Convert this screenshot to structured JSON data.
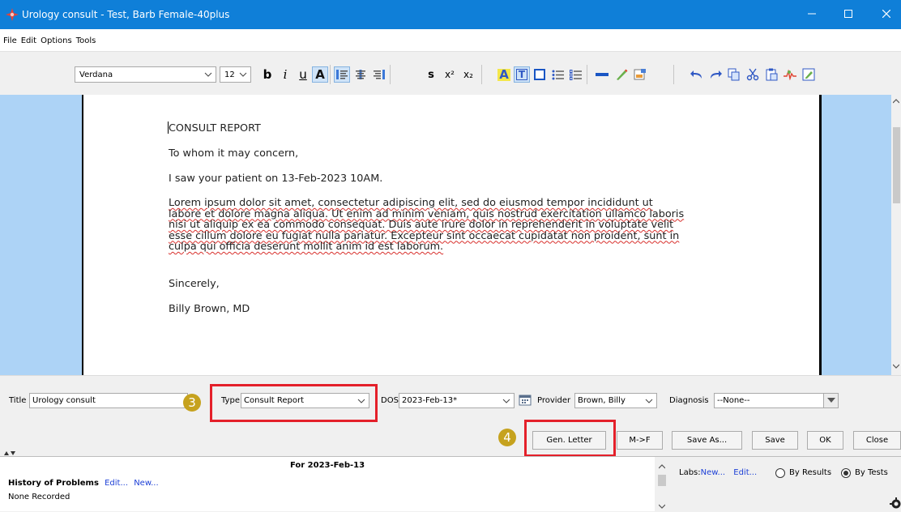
{
  "window": {
    "title": "Urology consult - Test, Barb Female-40plus",
    "minimize": "—",
    "maximize": "☐",
    "close": "✕"
  },
  "menu": [
    "File",
    "Edit",
    "Options",
    "Tools"
  ],
  "toolbar": {
    "font": "Verdana",
    "size": "12",
    "bold": "b",
    "italic": "i",
    "underline": "u",
    "font_color": "A",
    "strike": "s",
    "superscript": "x²",
    "subscript": "x₂",
    "highlight": "A",
    "text_box": "T"
  },
  "document": {
    "heading": "CONSULT REPORT",
    "greeting": "To whom it may concern,",
    "visit": "I saw your patient on 13-Feb-2023 10AM.",
    "body_lines": [
      "Lorem ipsum dolor sit amet, consectetur adipiscing elit, sed do eiusmod tempor incididunt ut",
      "labore et dolore magna aliqua. Ut enim ad minim veniam, quis nostrud exercitation ullamco laboris",
      "nisi ut aliquip ex ea commodo consequat. Duis aute irure dolor in reprehenderit in voluptate velit",
      "esse cillum dolore eu fugiat nulla pariatur. Excepteur sint occaecat cupidatat non proident, sunt in",
      "culpa qui officia deserunt mollit anim id est laborum."
    ],
    "closing": "Sincerely,",
    "signature": "Billy Brown, MD"
  },
  "fields": {
    "title_label": "Title",
    "title_value": "Urology consult",
    "type_label": "Type",
    "type_value": "Consult Report",
    "dos_label": "DOS",
    "dos_value": "2023-Feb-13*",
    "provider_label": "Provider",
    "provider_value": "Brown, Billy",
    "diagnosis_label": "Diagnosis",
    "diagnosis_value": "--None--"
  },
  "markers": {
    "step3": "3",
    "step4": "4"
  },
  "buttons": {
    "gen_letter": "Gen. Letter",
    "m_to_f": "M->F",
    "save_as": "Save As...",
    "save": "Save",
    "ok": "OK",
    "close": "Close"
  },
  "bottom": {
    "date_header": "For 2023-Feb-13",
    "problems_title": "History of Problems",
    "edit": "Edit...",
    "new": "New...",
    "none_recorded": "None Recorded",
    "labs_label": "Labs:",
    "labs_new": "New...",
    "labs_edit": "Edit...",
    "by_results": "By Results",
    "by_tests": "By Tests"
  },
  "colors": {
    "titlebar": "#0f7fd8",
    "editor_bg": "#add3f6",
    "highlight_red": "#e4202a",
    "marker_gold": "#c6a21e"
  }
}
